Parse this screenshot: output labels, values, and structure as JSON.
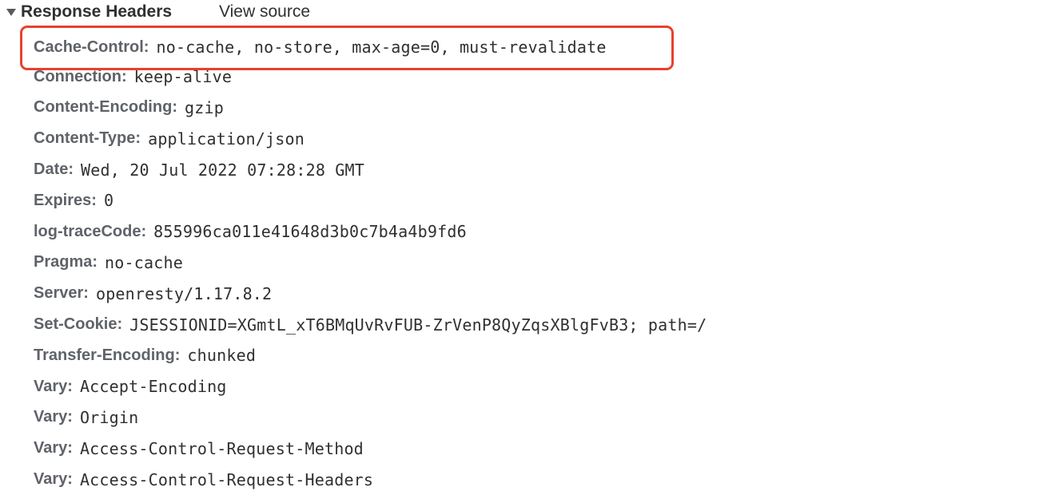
{
  "section": {
    "title": "Response Headers",
    "view_source_label": "View source"
  },
  "headers": [
    {
      "name": "Cache-Control",
      "value": "no-cache, no-store, max-age=0, must-revalidate"
    },
    {
      "name": "Connection",
      "value": "keep-alive"
    },
    {
      "name": "Content-Encoding",
      "value": "gzip"
    },
    {
      "name": "Content-Type",
      "value": "application/json"
    },
    {
      "name": "Date",
      "value": "Wed, 20 Jul 2022 07:28:28 GMT"
    },
    {
      "name": "Expires",
      "value": "0"
    },
    {
      "name": "log-traceCode",
      "value": "855996ca011e41648d3b0c7b4a4b9fd6"
    },
    {
      "name": "Pragma",
      "value": "no-cache"
    },
    {
      "name": "Server",
      "value": "openresty/1.17.8.2"
    },
    {
      "name": "Set-Cookie",
      "value": "JSESSIONID=XGmtL_xT6BMqUvRvFUB-ZrVenP8QyZqsXBlgFvB3; path=/"
    },
    {
      "name": "Transfer-Encoding",
      "value": "chunked"
    },
    {
      "name": "Vary",
      "value": "Accept-Encoding"
    },
    {
      "name": "Vary",
      "value": "Origin"
    },
    {
      "name": "Vary",
      "value": "Access-Control-Request-Method"
    },
    {
      "name": "Vary",
      "value": "Access-Control-Request-Headers"
    }
  ],
  "colors": {
    "highlight": "#e8412e"
  }
}
